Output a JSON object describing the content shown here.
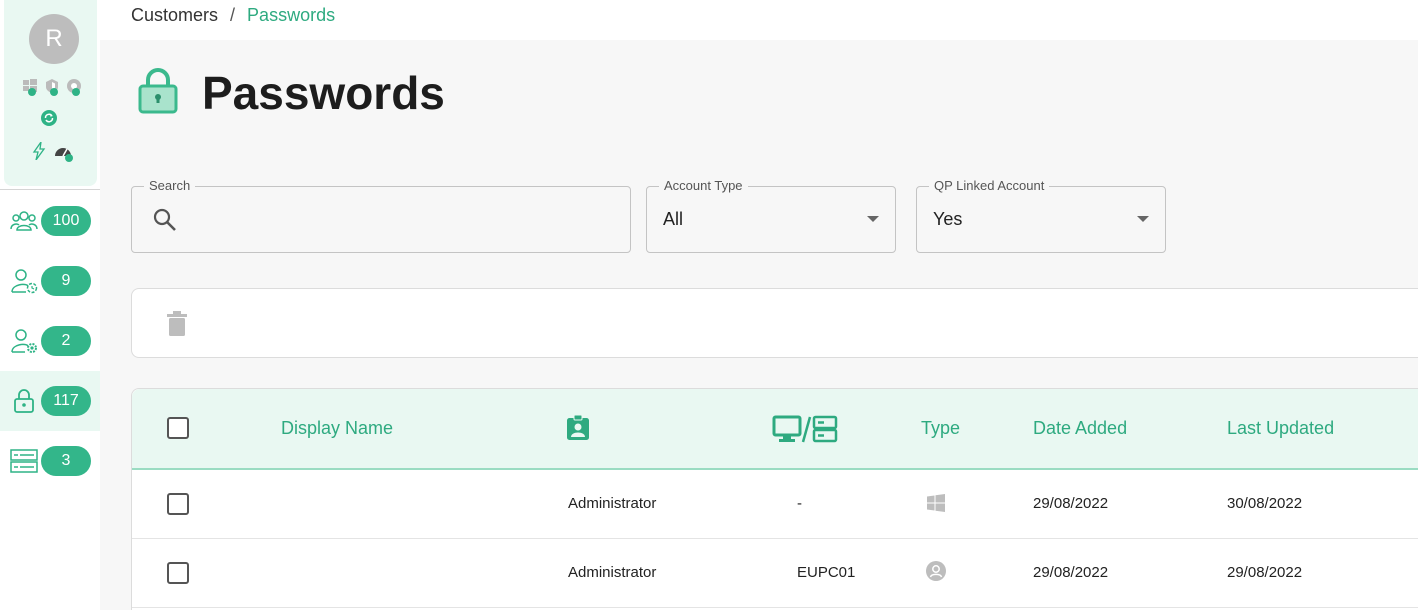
{
  "profile": {
    "avatar_initial": "R"
  },
  "nav": {
    "items": [
      {
        "icon": "users-group-icon",
        "count": "100"
      },
      {
        "icon": "user-clock-icon",
        "count": "9"
      },
      {
        "icon": "user-gear-icon",
        "count": "2"
      },
      {
        "icon": "lock-icon",
        "count": "117",
        "active": true
      },
      {
        "icon": "server-icon",
        "count": "3"
      }
    ]
  },
  "breadcrumb": {
    "root": "Customers",
    "separator": "/",
    "current": "Passwords"
  },
  "page": {
    "title": "Passwords"
  },
  "filters": {
    "search": {
      "label": "Search",
      "value": "",
      "placeholder": ""
    },
    "account_type": {
      "label": "Account Type",
      "value": "All"
    },
    "qp_linked": {
      "label": "QP Linked Account",
      "value": "Yes"
    }
  },
  "table": {
    "headers": {
      "display_name": "Display Name",
      "type": "Type",
      "date_added": "Date Added",
      "last_updated": "Last Updated"
    },
    "rows": [
      {
        "display_name": "",
        "account": "Administrator",
        "device": "-",
        "type_icon": "windows-icon",
        "date_added": "29/08/2022",
        "last_updated": "30/08/2022"
      },
      {
        "display_name": "",
        "account": "Administrator",
        "device": "EUPC01",
        "type_icon": "user-circle-icon",
        "date_added": "29/08/2022",
        "last_updated": "29/08/2022"
      }
    ]
  },
  "colors": {
    "accent": "#2eaa80",
    "accent_light": "#e9f8f2",
    "badge": "#33b68a"
  }
}
